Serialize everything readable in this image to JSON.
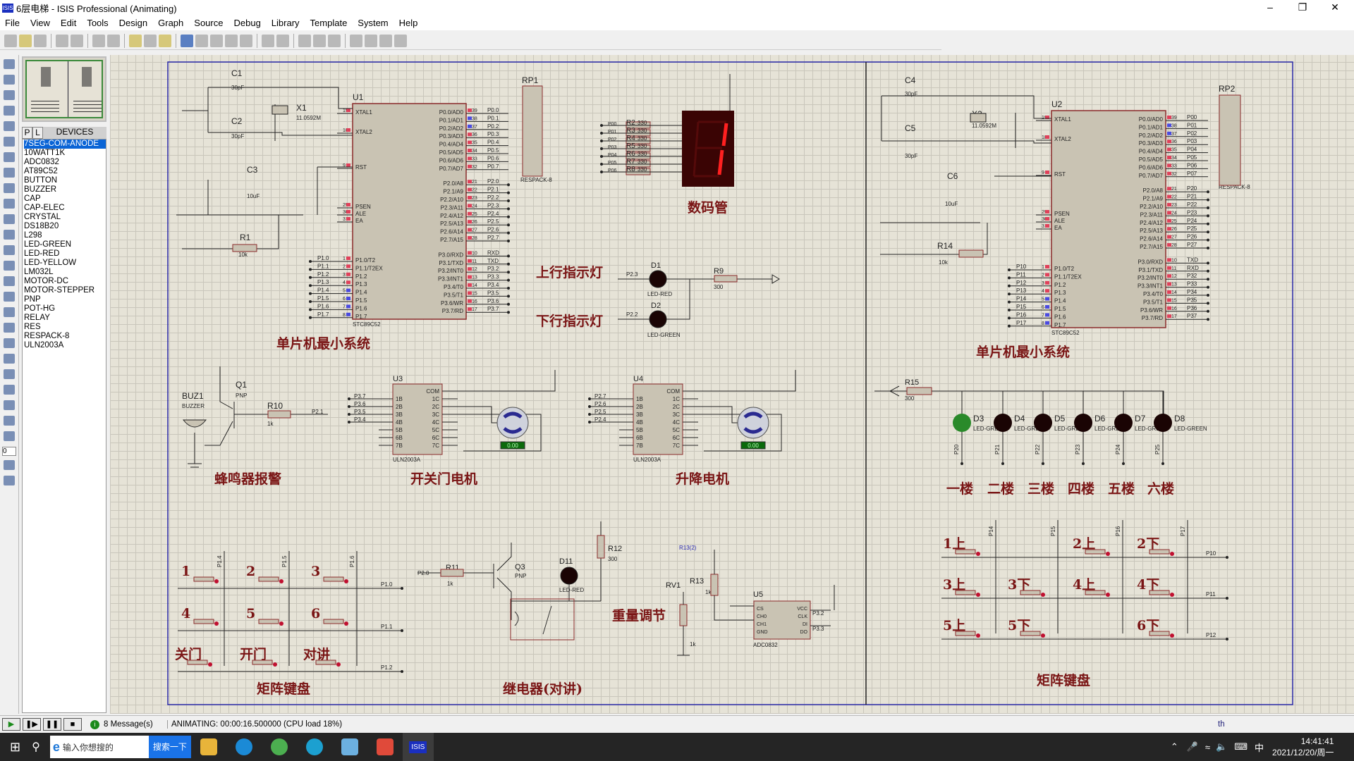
{
  "window": {
    "title": "6层电梯 - ISIS Professional (Animating)",
    "app_icon": "ISIS"
  },
  "menu": [
    "File",
    "View",
    "Edit",
    "Tools",
    "Design",
    "Graph",
    "Source",
    "Debug",
    "Library",
    "Template",
    "System",
    "Help"
  ],
  "device_panel": {
    "tab_p": "P",
    "tab_l": "L",
    "title": "DEVICES",
    "selected": "7SEG-COM-ANODE",
    "items": [
      "7SEG-COM-ANODE",
      "10WATT1K",
      "ADC0832",
      "AT89C52",
      "BUTTON",
      "BUZZER",
      "CAP",
      "CAP-ELEC",
      "CRYSTAL",
      "DS18B20",
      "L298",
      "LED-GREEN",
      "LED-RED",
      "LED-YELLOW",
      "LM032L",
      "MOTOR-DC",
      "MOTOR-STEPPER",
      "PNP",
      "POT-HG",
      "RELAY",
      "RES",
      "RESPACK-8",
      "ULN2003A"
    ]
  },
  "rotation_value": "0",
  "schematic": {
    "section_labels": {
      "mcu_left": "单片机最小系统",
      "mcu_right": "单片机最小系统",
      "seg": "数码管",
      "up_light": "上行指示灯",
      "down_light": "下行指示灯",
      "buzzer": "蜂鸣器报警",
      "door_motor": "开关门电机",
      "lift_motor": "升降电机",
      "floors": [
        "一楼",
        "二楼",
        "三楼",
        "四楼",
        "五楼",
        "六楼"
      ],
      "keypad_left": "矩阵键盘",
      "relay": "继电器(对讲)",
      "weight": "重量调节",
      "keypad_right": "矩阵键盘"
    },
    "mcu": {
      "part": "STC89C52",
      "left_pins": [
        [
          "19",
          "XTAL1"
        ],
        [
          "18",
          "XTAL2"
        ],
        [
          "9",
          "RST"
        ],
        [
          "29",
          "PSEN"
        ],
        [
          "30",
          "ALE"
        ],
        [
          "31",
          "EA"
        ],
        [
          "1",
          "P1.0/T2"
        ],
        [
          "2",
          "P1.1/T2EX"
        ],
        [
          "3",
          "P1.2"
        ],
        [
          "4",
          "P1.3"
        ],
        [
          "5",
          "P1.4"
        ],
        [
          "6",
          "P1.5"
        ],
        [
          "7",
          "P1.6"
        ],
        [
          "8",
          "P1.7"
        ]
      ],
      "right_pins": [
        [
          "39",
          "P0.0/AD0"
        ],
        [
          "38",
          "P0.1/AD1"
        ],
        [
          "37",
          "P0.2/AD2"
        ],
        [
          "36",
          "P0.3/AD3"
        ],
        [
          "35",
          "P0.4/AD4"
        ],
        [
          "34",
          "P0.5/AD5"
        ],
        [
          "33",
          "P0.6/AD6"
        ],
        [
          "32",
          "P0.7/AD7"
        ],
        [
          "21",
          "P2.0/A8"
        ],
        [
          "22",
          "P2.1/A9"
        ],
        [
          "23",
          "P2.2/A10"
        ],
        [
          "24",
          "P2.3/A11"
        ],
        [
          "25",
          "P2.4/A12"
        ],
        [
          "26",
          "P2.5/A13"
        ],
        [
          "27",
          "P2.6/A14"
        ],
        [
          "28",
          "P2.7/A15"
        ],
        [
          "10",
          "P3.0/RXD"
        ],
        [
          "11",
          "P3.1/TXD"
        ],
        [
          "12",
          "P3.2/INT0"
        ],
        [
          "13",
          "P3.3/INT1"
        ],
        [
          "14",
          "P3.4/T0"
        ],
        [
          "15",
          "P3.5/T1"
        ],
        [
          "16",
          "P3.6/WR"
        ],
        [
          "17",
          "P3.7/RD"
        ]
      ],
      "u1": {
        "ref": "U1",
        "nets_left": [
          "P1.0",
          "P1.1",
          "P1.2",
          "P1.3",
          "P1.4",
          "P1.5",
          "P1.6",
          "P1.7"
        ],
        "nets_right": [
          "P0.0",
          "P0.1",
          "P0.2",
          "P0.3",
          "P0.4",
          "P0.5",
          "P0.6",
          "P0.7",
          "P2.0",
          "P2.1",
          "P2.2",
          "P2.3",
          "P2.4",
          "P2.5",
          "P2.6",
          "P2.7",
          "RXD",
          "TXD",
          "P3.2",
          "P3.3",
          "P3.4",
          "P3.5",
          "P3.6",
          "P3.7"
        ]
      },
      "u2": {
        "ref": "U2",
        "nets_left": [
          "P10",
          "P11",
          "P12",
          "P13",
          "P14",
          "P15",
          "P16",
          "P17"
        ],
        "nets_right": [
          "P00",
          "P01",
          "P02",
          "P03",
          "P04",
          "P05",
          "P06",
          "P07",
          "P20",
          "P21",
          "P22",
          "P23",
          "P24",
          "P25",
          "P26",
          "P27",
          "TXD",
          "RXD",
          "P32",
          "P33",
          "P34",
          "P35",
          "P36",
          "P37"
        ]
      }
    },
    "parts_left": {
      "c1": "C1",
      "c2": "C2",
      "cval": "30pF",
      "x1": "X1",
      "xval": "11.0592M",
      "c3": "C3",
      "c3val": "10uF",
      "r1": "R1",
      "r1val": "10k",
      "rp1": "RP1",
      "respack": "RESPACK-8"
    },
    "parts_right": {
      "c4": "C4",
      "c5": "C5",
      "x2": "X2",
      "c6": "C6",
      "r14": "R14",
      "rp2": "RP2"
    },
    "seg": {
      "resistors": [
        "R2",
        "R3",
        "R4",
        "R5",
        "R6",
        "R7",
        "R8"
      ],
      "rval": "330",
      "nets": [
        "P00",
        "P01",
        "P02",
        "P03",
        "P04",
        "P05",
        "P06"
      ],
      "digit": "1"
    },
    "lights": {
      "d1": "D1",
      "d1type": "LED-RED",
      "d1net": "P2.3",
      "d2": "D2",
      "d2type": "LED-GREEN",
      "d2net": "P2.2",
      "r9": "R9",
      "r9val": "300"
    },
    "buzzer": {
      "ref": "BUZ1",
      "type": "BUZZER",
      "q1": "Q1",
      "qtype": "PNP",
      "r10": "R10",
      "r10val": "1k",
      "net": "P2.1"
    },
    "u3": {
      "ref": "U3",
      "part": "ULN2003A",
      "nets": [
        "P3.7",
        "P3.6",
        "P3.5",
        "P3.4"
      ],
      "motor_readout": "0.00"
    },
    "u4": {
      "ref": "U4",
      "part": "ULN2003A",
      "nets": [
        "P2.7",
        "P2.6",
        "P2.5",
        "P2.4"
      ],
      "motor_readout": "0.00"
    },
    "uln_left": [
      "1B",
      "2B",
      "3B",
      "4B",
      "5B",
      "6B",
      "7B"
    ],
    "uln_right": [
      "COM",
      "1C",
      "2C",
      "3C",
      "4C",
      "5C",
      "6C",
      "7C"
    ],
    "floor_leds": {
      "r15": "R15",
      "r15val": "300",
      "refs": [
        "D3",
        "D4",
        "D5",
        "D6",
        "D7",
        "D8"
      ],
      "type": "LED-GREEN",
      "nets": [
        "P20",
        "P21",
        "P22",
        "P23",
        "P24",
        "P25"
      ],
      "lit": [
        true,
        false,
        false,
        false,
        false,
        false
      ]
    },
    "keypad_left": {
      "keys": [
        "1",
        "2",
        "3",
        "4",
        "5",
        "6",
        "关门",
        "开门",
        "对讲"
      ],
      "row_nets": [
        "P1.0",
        "P1.1",
        "P1.2"
      ],
      "col_nets": [
        "P1.4",
        "P1.5",
        "P1.6"
      ]
    },
    "relay": {
      "q3": "Q3",
      "qtype": "PNP",
      "r11": "R11",
      "r11val": "1k",
      "net": "P2.0",
      "d11": "D11",
      "d11type": "LED-RED",
      "r12": "R12",
      "r12val": "300"
    },
    "adc": {
      "rv1": "RV1",
      "r13": "R13",
      "r13val": "1k",
      "rvval": "1k",
      "u5": "U5",
      "part": "ADC0832",
      "r13net": "R13(2)",
      "pins_l": [
        "CS",
        "CH0",
        "CH1",
        "GND"
      ],
      "pins_r": [
        "VCC",
        "CLK",
        "DI",
        "DO"
      ],
      "nets": [
        "P3.2",
        "P3.3"
      ]
    },
    "keypad_right": {
      "keys": [
        "1上",
        "2上",
        "2下",
        "3上",
        "3下",
        "4上",
        "4下",
        "5上",
        "5下",
        "6下"
      ],
      "row_nets": [
        "P10",
        "P11",
        "P12"
      ],
      "col_nets": [
        "P14",
        "P15",
        "P16",
        "P17"
      ]
    }
  },
  "status": {
    "messages": "8 Message(s)",
    "animating": "ANIMATING: 00:00:16.500000 (CPU load 18%)",
    "right": "th"
  },
  "taskbar": {
    "search_placeholder": "输入你想搜的",
    "search_button": "搜索一下",
    "ime": "中",
    "time": "14:41:41",
    "date": "2021/12/20/周一",
    "app": "ISIS"
  }
}
